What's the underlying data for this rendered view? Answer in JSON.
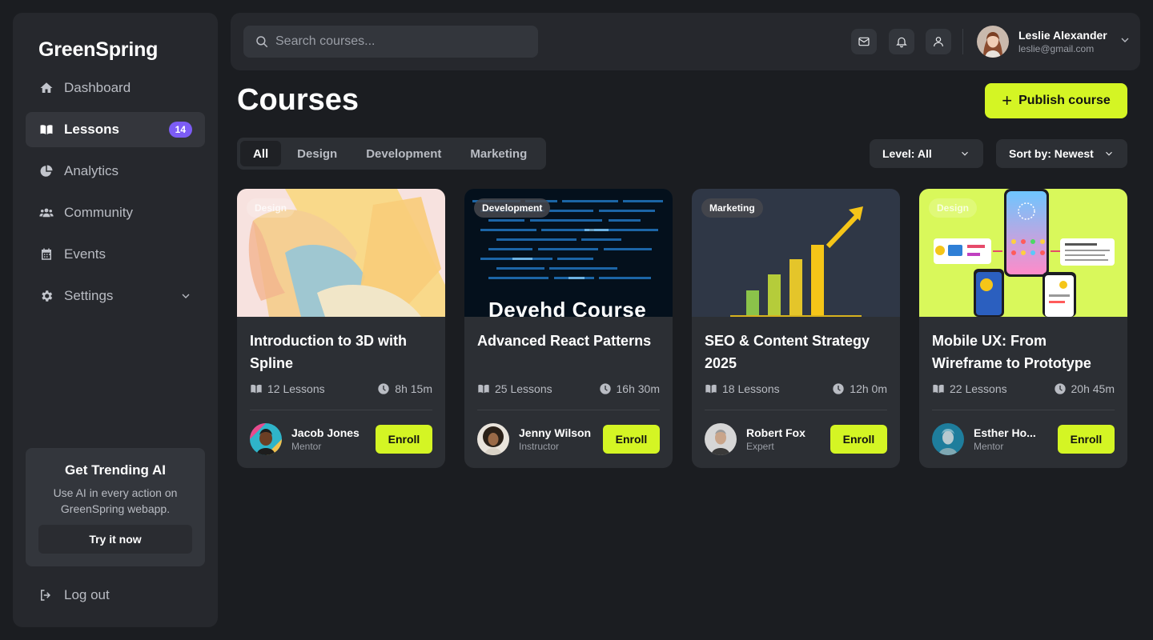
{
  "brand": "GreenSpring",
  "sidebar": {
    "items": [
      {
        "label": "Dashboard",
        "icon": "home-icon"
      },
      {
        "label": "Lessons",
        "icon": "book-icon",
        "badge": "14",
        "active": true
      },
      {
        "label": "Analytics",
        "icon": "pie-chart-icon"
      },
      {
        "label": "Community",
        "icon": "users-icon"
      },
      {
        "label": "Events",
        "icon": "calendar-icon"
      },
      {
        "label": "Settings",
        "icon": "gear-icon"
      }
    ],
    "promo": {
      "title": "Get Trending AI",
      "text": "Use AI in every action on GreenSpring webapp.",
      "button": "Try it now"
    },
    "logout": "Log out"
  },
  "topbar": {
    "search_placeholder": "Search courses...",
    "user": {
      "name": "Leslie Alexander",
      "email": "leslie@gmail.com"
    }
  },
  "page": {
    "title": "Courses",
    "publish_label": "Publish course",
    "filters": [
      "All",
      "Design",
      "Development",
      "Marketing"
    ],
    "active_filter": "All",
    "level": "Level: All",
    "sort": "Sort by: Newest"
  },
  "courses": [
    {
      "tag": "Design",
      "title": "Introduction to 3D with Spline",
      "lessons": "12 Lessons",
      "duration": "8h 15m",
      "instructor": "Jacob Jones",
      "role": "Mentor",
      "enroll": "Enroll"
    },
    {
      "tag": "Development",
      "title": "Advanced React Patterns",
      "lessons": "25 Lessons",
      "duration": "16h 30m",
      "instructor": "Jenny Wilson",
      "role": "Instructor",
      "enroll": "Enroll",
      "thumb_text": "Devehd Course"
    },
    {
      "tag": "Marketing",
      "title": "SEO & Content Strategy 2025",
      "lessons": "18 Lessons",
      "duration": "12h 0m",
      "instructor": "Robert Fox",
      "role": "Expert",
      "enroll": "Enroll"
    },
    {
      "tag": "Design",
      "title": "Mobile UX: From Wireframe to Prototype",
      "lessons": "22 Lessons",
      "duration": "20h 45m",
      "instructor": "Esther Ho...",
      "role": "Mentor",
      "enroll": "Enroll"
    }
  ],
  "colors": {
    "accent": "#d4f524",
    "badge": "#7c5cf5",
    "background": "#1b1d21",
    "panel": "#26282d"
  }
}
